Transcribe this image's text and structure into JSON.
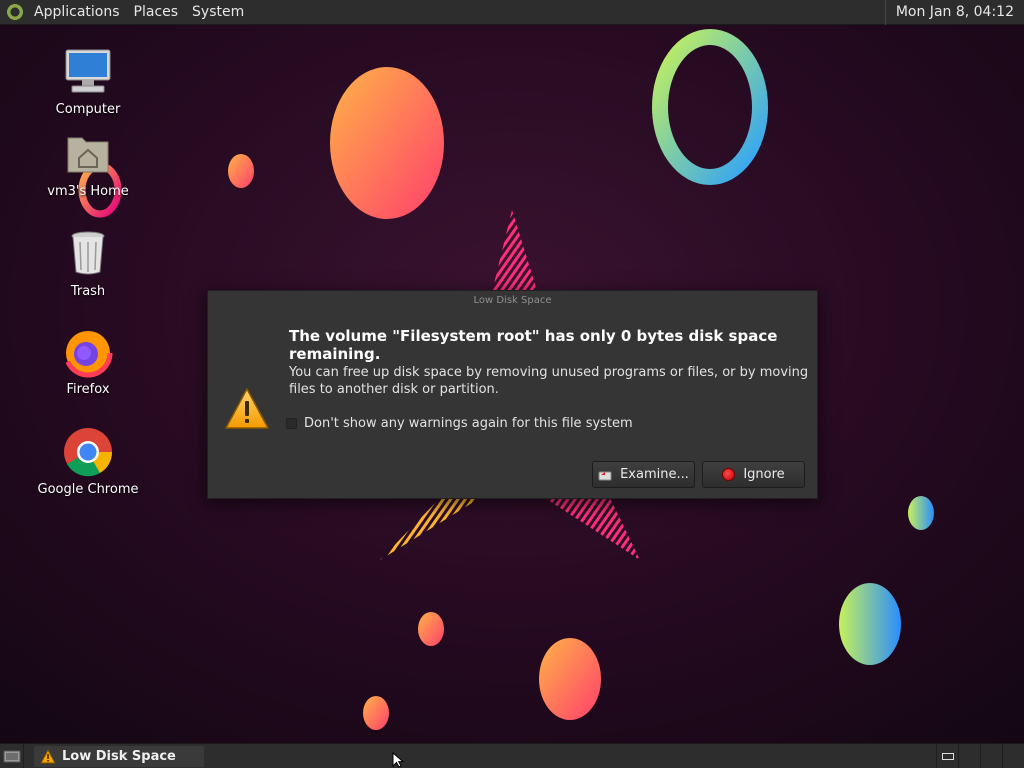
{
  "top_panel": {
    "menus": [
      "Applications",
      "Places",
      "System"
    ],
    "clock": "Mon Jan  8, 04:12"
  },
  "desktop_icons": [
    {
      "label": "Computer",
      "icon": "computer-icon"
    },
    {
      "label": "vm3's Home",
      "icon": "home-folder-icon"
    },
    {
      "label": "Trash",
      "icon": "trash-icon"
    },
    {
      "label": "Firefox",
      "icon": "firefox-icon"
    },
    {
      "label": "Google Chrome",
      "icon": "chrome-icon"
    }
  ],
  "dialog": {
    "title": "Low Disk Space",
    "heading": "The volume \"Filesystem root\" has only 0 bytes disk space remaining.",
    "body": "You can free up disk space by removing unused programs or files, or by moving files to another disk or partition.",
    "checkbox_label": "Don't show any warnings again for this file system",
    "checkbox_checked": false,
    "examine_label": "Examine...",
    "ignore_label": "Ignore"
  },
  "bottom_panel": {
    "task_label": "Low Disk Space",
    "workspaces": 4,
    "active_workspace": 1
  },
  "colors": {
    "panel_bg": "#2d2d2d",
    "dialog_bg": "#353535",
    "wallpaper_bg": "#1a0b1a"
  }
}
